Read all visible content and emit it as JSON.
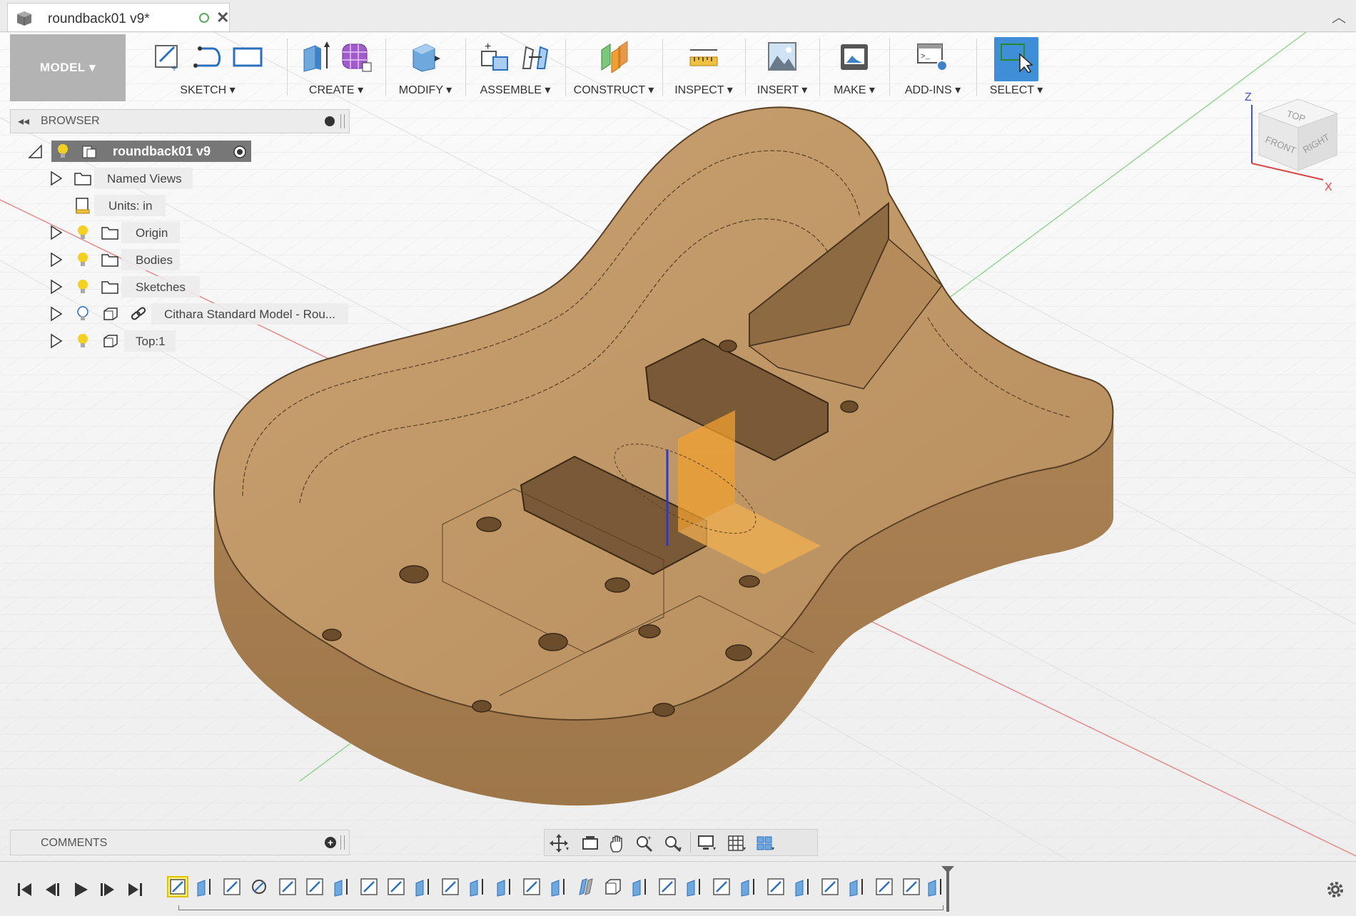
{
  "document_tab": {
    "name": "roundback01 v9*"
  },
  "toolbar": {
    "workspace": "MODEL",
    "groups": [
      {
        "label": "SKETCH"
      },
      {
        "label": "CREATE"
      },
      {
        "label": "MODIFY"
      },
      {
        "label": "ASSEMBLE"
      },
      {
        "label": "CONSTRUCT"
      },
      {
        "label": "INSPECT"
      },
      {
        "label": "INSERT"
      },
      {
        "label": "MAKE"
      },
      {
        "label": "ADD-INS"
      },
      {
        "label": "SELECT"
      }
    ],
    "dropdown_glyph": "▾"
  },
  "browser": {
    "title": "BROWSER",
    "root": "roundback01 v9",
    "items": [
      {
        "label": "Named Views"
      },
      {
        "label": "Units: in"
      },
      {
        "label": "Origin"
      },
      {
        "label": "Bodies"
      },
      {
        "label": "Sketches"
      },
      {
        "label": "Cithara Standard Model - Rou..."
      },
      {
        "label": "Top:1"
      }
    ]
  },
  "comments": {
    "title": "COMMENTS"
  },
  "viewcube": {
    "top": "TOP",
    "front": "FRONT",
    "right": "RIGHT",
    "axis_z": "Z",
    "axis_x": "X"
  },
  "colors": {
    "wood": "#c69c6d",
    "select_blue": "#3e8fd8",
    "orange_gizmo": "#f0a030"
  }
}
